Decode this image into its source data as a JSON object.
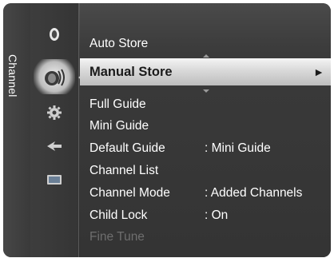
{
  "side_tab": {
    "label": "Channel"
  },
  "icons": [
    {
      "name": "picture-icon"
    },
    {
      "name": "sound-icon"
    },
    {
      "name": "setup-icon"
    },
    {
      "name": "input-icon"
    },
    {
      "name": "application-icon"
    }
  ],
  "menu": {
    "items": [
      {
        "label": "Auto Store",
        "value": ""
      },
      {
        "label": "Manual Store",
        "value": "",
        "selected": true,
        "arrow": "►"
      },
      {
        "label": "Full Guide",
        "value": ""
      },
      {
        "label": "Mini Guide",
        "value": ""
      },
      {
        "label": "Default Guide",
        "value": ": Mini Guide"
      },
      {
        "label": "Channel List",
        "value": ""
      },
      {
        "label": "Channel Mode",
        "value": ": Added Channels"
      },
      {
        "label": "Child Lock",
        "value": ": On"
      },
      {
        "label": "Fine Tune",
        "value": "",
        "disabled": true
      }
    ]
  },
  "colors": {
    "panel_bg": "#353535",
    "highlight_bg": "#d9d9d9",
    "text": "#ffffff",
    "disabled_text": "#6e6e6e"
  }
}
